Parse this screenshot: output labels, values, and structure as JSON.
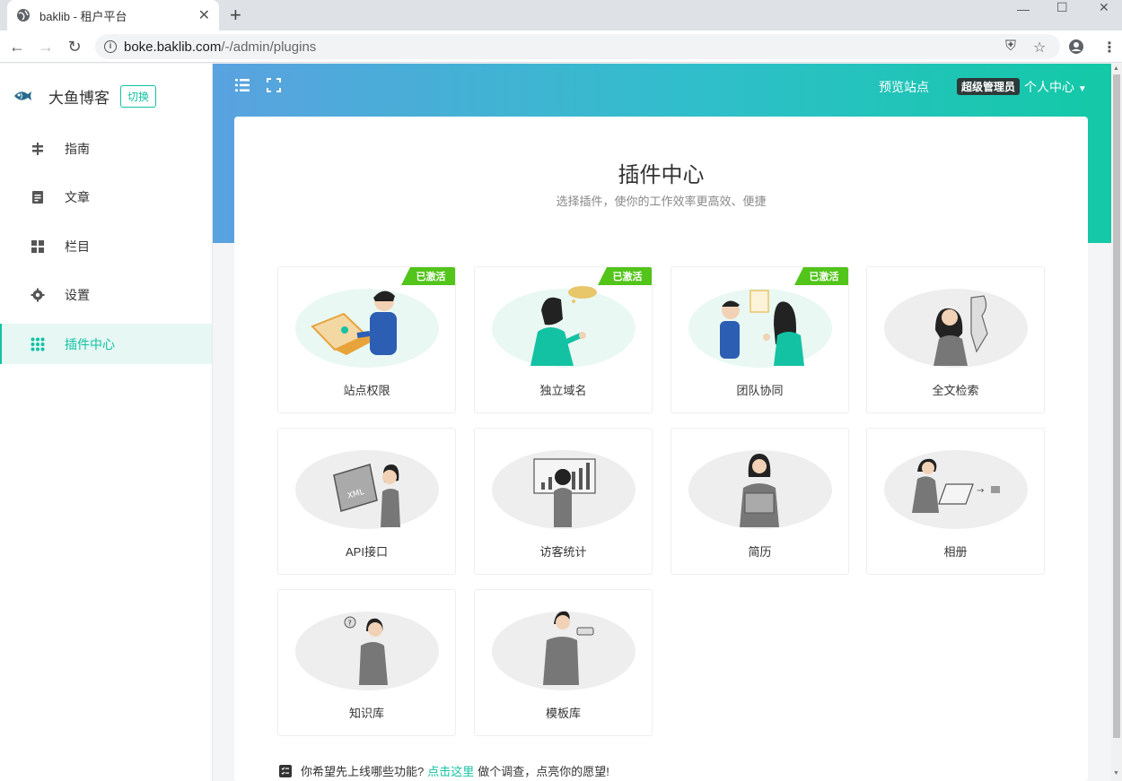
{
  "browser": {
    "tab_title": "baklib - 租户平台",
    "url_host": "boke.baklib.com",
    "url_path": "/-/admin/plugins"
  },
  "sidebar": {
    "brand_name": "大鱼博客",
    "switch_label": "切换",
    "items": [
      {
        "label": "指南",
        "icon": "signpost-icon"
      },
      {
        "label": "文章",
        "icon": "article-icon"
      },
      {
        "label": "栏目",
        "icon": "grid-icon"
      },
      {
        "label": "设置",
        "icon": "gear-icon"
      },
      {
        "label": "插件中心",
        "icon": "apps-icon",
        "active": true
      }
    ]
  },
  "header": {
    "preview_label": "预览站点",
    "role_badge": "超级管理员",
    "user_menu_label": "个人中心"
  },
  "plugins": {
    "title": "插件中心",
    "subtitle": "选择插件，使你的工作效率更高效、便捷",
    "activated_label": "已激活",
    "items": [
      {
        "label": "站点权限",
        "activated": true
      },
      {
        "label": "独立域名",
        "activated": true
      },
      {
        "label": "团队协同",
        "activated": true
      },
      {
        "label": "全文检索",
        "activated": false
      },
      {
        "label": "API接口",
        "activated": false
      },
      {
        "label": "访客统计",
        "activated": false
      },
      {
        "label": "简历",
        "activated": false
      },
      {
        "label": "相册",
        "activated": false
      },
      {
        "label": "知识库",
        "activated": false
      },
      {
        "label": "模板库",
        "activated": false
      }
    ]
  },
  "footer": {
    "prefix": "你希望先上线哪些功能?",
    "link": "点击这里",
    "suffix": "做个调查，点亮你的愿望!"
  },
  "colors": {
    "accent": "#13c2a3",
    "badge_green": "#52c41a"
  }
}
